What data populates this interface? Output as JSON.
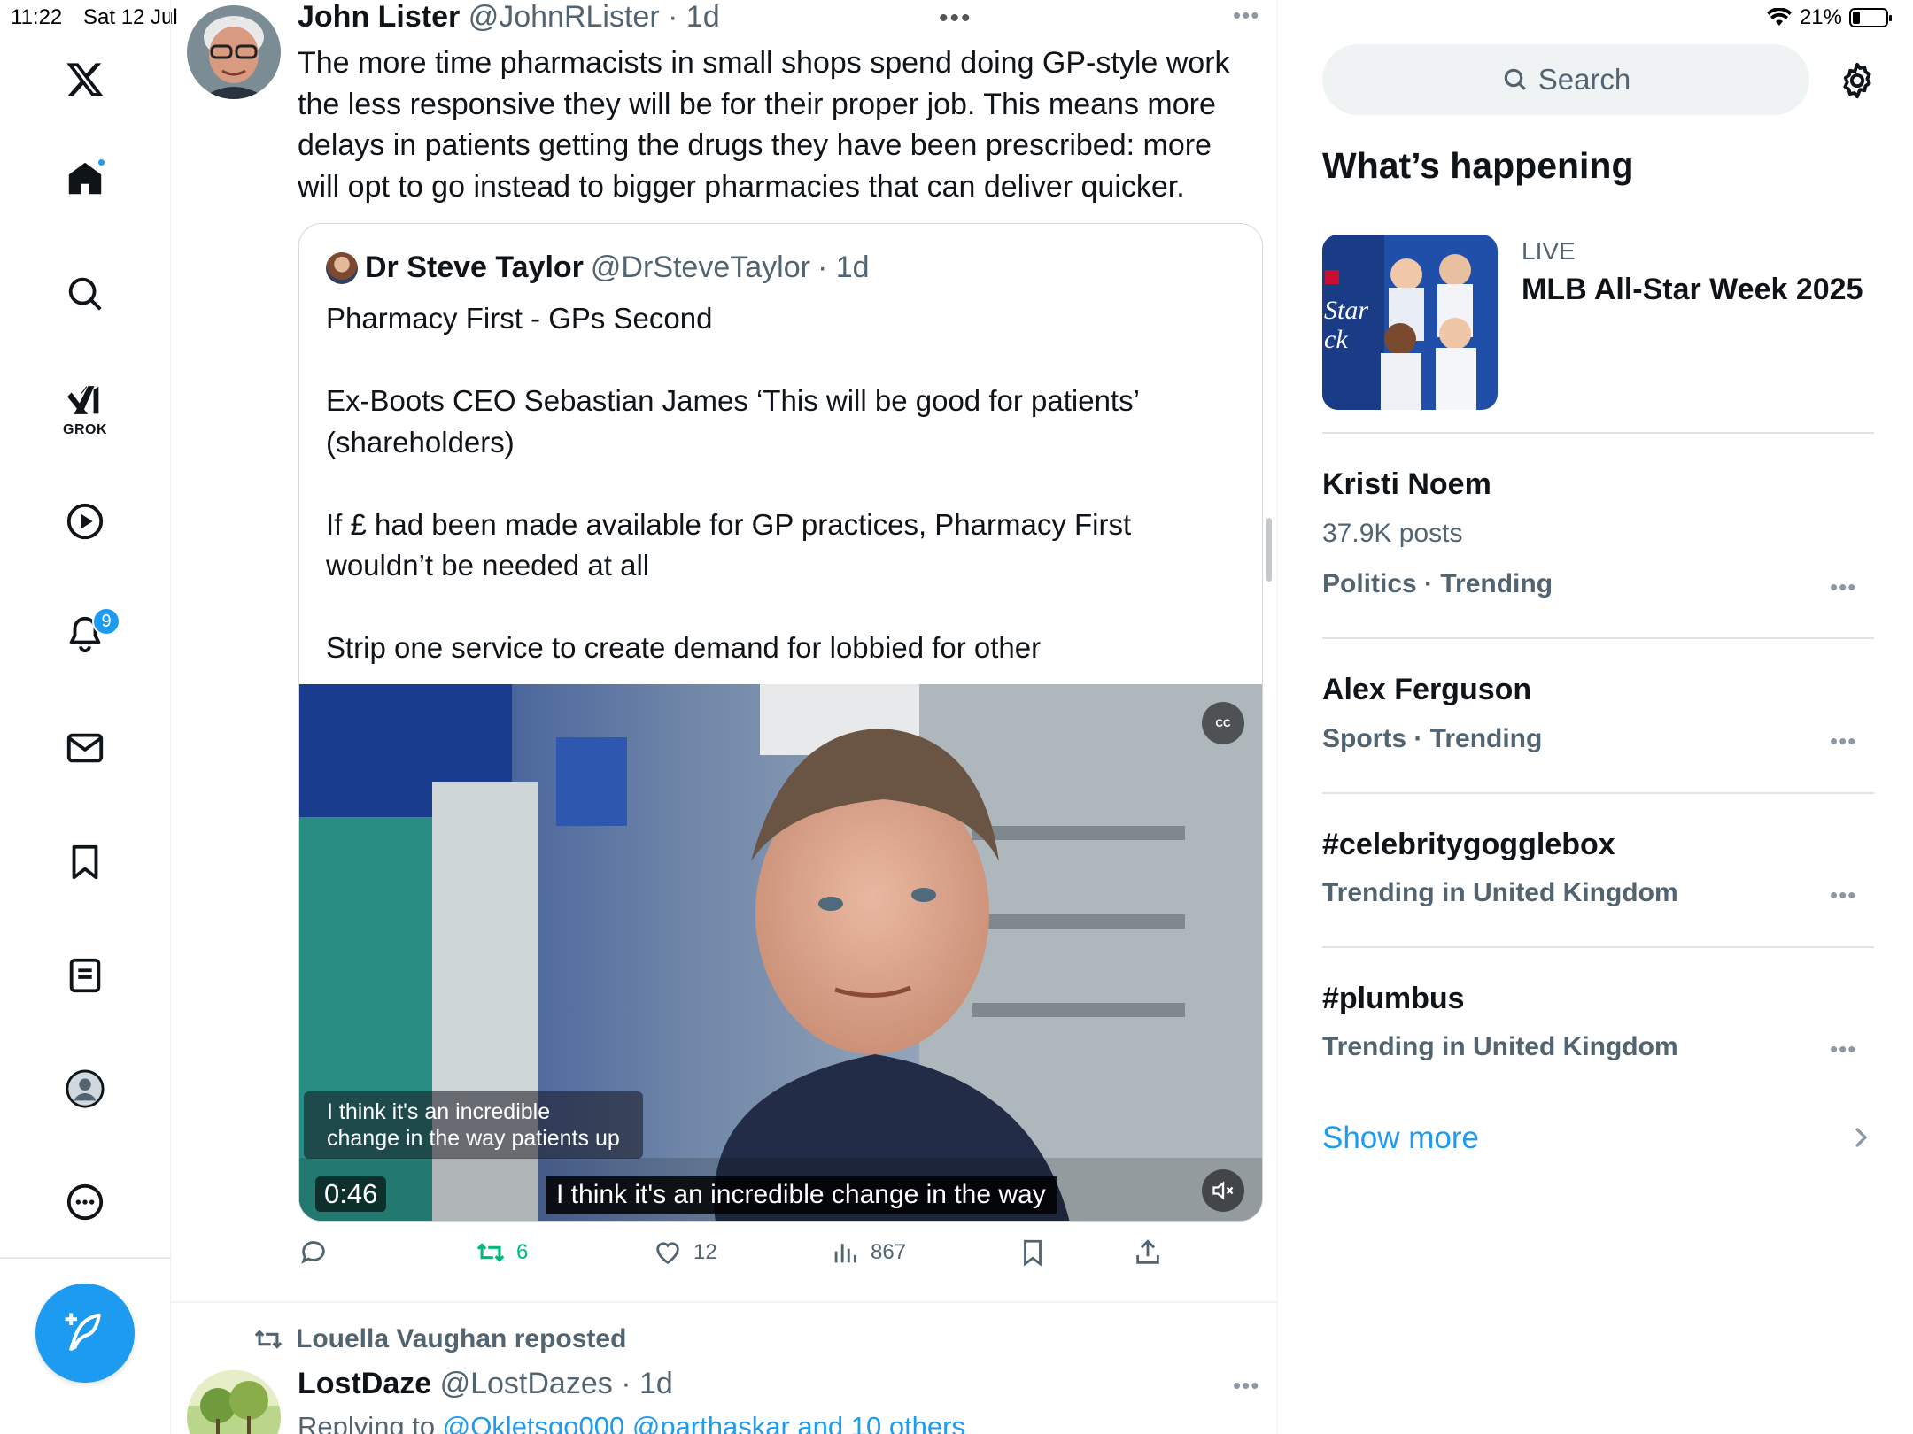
{
  "status": {
    "time": "11:22",
    "date": "Sat 12 Jul",
    "battery": "21%"
  },
  "nav": {
    "grok_label": "GROK",
    "notification_count": "9",
    "items": [
      "x-logo-icon",
      "home-icon",
      "search-icon",
      "grok-icon",
      "video-icon",
      "notifications-icon",
      "messages-icon",
      "bookmarks-icon",
      "lists-icon",
      "profile-icon",
      "more-icon"
    ]
  },
  "tweet": {
    "author": "John Lister",
    "handle": "@JohnRLister",
    "time": "· 1d",
    "text": "The more time pharmacists in small shops spend doing GP-style work the less responsive they will be for their proper job.  This means more delays in patients getting the drugs they have been prescribed: more will opt to go instead to bigger pharmacies that can deliver quicker.",
    "quote": {
      "author": "Dr Steve Taylor",
      "handle": "@DrSteveTaylor",
      "time": "· 1d",
      "text": "Pharmacy First - GPs Second\n\nEx-Boots CEO Sebastian James ‘This will be good for patients’ (shareholders)\n\nIf £ had been made available for GP practices, Pharmacy First wouldn’t be needed at all\n\nStrip one service to create demand for lobbied for other",
      "video": {
        "burned_subtitle": "I think it's an incredible\nchange in the way patients up",
        "duration": "0:46",
        "caption": "I think it's an incredible change in the way",
        "cc_label": "CC"
      }
    },
    "actions": {
      "retweets": "6",
      "likes": "12",
      "views": "867"
    }
  },
  "next_tweet": {
    "reposted_by": "Louella Vaughan reposted",
    "author": "LostDaze",
    "handle": "@LostDazes",
    "time": "· 1d",
    "replying_prefix": "Replying to ",
    "replying_to": "@Okletsgo000 @parthaskar and 10 others"
  },
  "sidebar": {
    "search_placeholder": "Search",
    "section_title": "What’s happening",
    "event": {
      "status": "LIVE",
      "title": "MLB All-Star Week 2025"
    },
    "trends": [
      {
        "title": "Kristi Noem",
        "posts": "37.9K posts",
        "category": "Politics · Trending"
      },
      {
        "title": "Alex Ferguson",
        "category": "Sports · Trending"
      },
      {
        "title": "#celebritygogglebox",
        "category": "Trending in United Kingdom"
      },
      {
        "title": "#plumbus",
        "category": "Trending in United Kingdom"
      }
    ],
    "show_more": "Show more"
  },
  "colors": {
    "accent": "#1d9bf0",
    "retweet": "#00ba7c",
    "secondary_text": "#536471"
  }
}
